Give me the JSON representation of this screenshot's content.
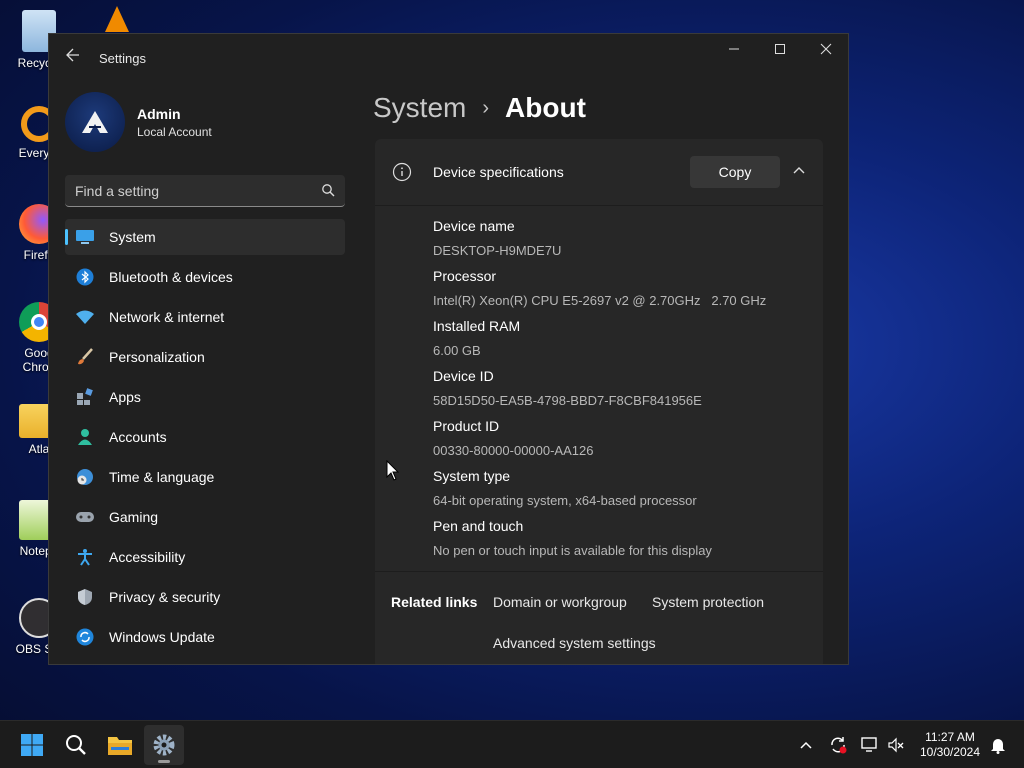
{
  "desktop": {
    "icons": [
      {
        "label": "Recycle"
      },
      {
        "label": "Everyth"
      },
      {
        "label": "Firefo"
      },
      {
        "label": "Goog Chron"
      },
      {
        "label": "Atla"
      },
      {
        "label": "Notepa"
      },
      {
        "label": "OBS Stu"
      }
    ]
  },
  "window": {
    "title": "Settings"
  },
  "profile": {
    "name": "Admin",
    "account_type": "Local Account"
  },
  "search": {
    "placeholder": "Find a setting"
  },
  "nav": {
    "items": [
      {
        "label": "System",
        "active": true
      },
      {
        "label": "Bluetooth & devices"
      },
      {
        "label": "Network & internet"
      },
      {
        "label": "Personalization"
      },
      {
        "label": "Apps"
      },
      {
        "label": "Accounts"
      },
      {
        "label": "Time & language"
      },
      {
        "label": "Gaming"
      },
      {
        "label": "Accessibility"
      },
      {
        "label": "Privacy & security"
      },
      {
        "label": "Windows Update"
      }
    ]
  },
  "breadcrumb": {
    "parent": "System",
    "separator": "›",
    "current": "About"
  },
  "device_specs": {
    "title": "Device specifications",
    "copy_label": "Copy",
    "items": [
      {
        "key": "Device name",
        "value": "DESKTOP-H9MDE7U"
      },
      {
        "key": "Processor",
        "value": "Intel(R) Xeon(R) CPU E5-2697 v2 @ 2.70GHz   2.70 GHz"
      },
      {
        "key": "Installed RAM",
        "value": "6.00 GB"
      },
      {
        "key": "Device ID",
        "value": "58D15D50-EA5B-4798-BBD7-F8CBF841956E"
      },
      {
        "key": "Product ID",
        "value": "00330-80000-00000-AA126"
      },
      {
        "key": "System type",
        "value": "64-bit operating system, x64-based processor"
      },
      {
        "key": "Pen and touch",
        "value": "No pen or touch input is available for this display"
      }
    ]
  },
  "related_links": {
    "title": "Related links",
    "links": [
      "Domain or workgroup",
      "System protection",
      "Advanced system settings"
    ]
  },
  "taskbar": {
    "time": "11:27 AM",
    "date": "10/30/2024"
  },
  "colors": {
    "accent": "#4cc2ff",
    "window_bg": "#202020",
    "card_bg": "#272727"
  }
}
